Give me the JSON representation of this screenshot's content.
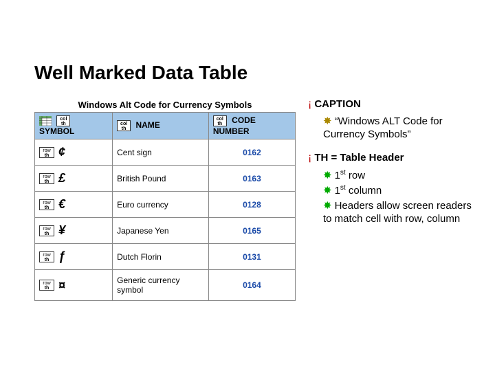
{
  "title": "Well Marked Data Table",
  "table": {
    "caption": "Windows Alt Code for Currency Symbols",
    "headers": {
      "symbol": "SYMBOL",
      "name": "NAME",
      "code": "CODE NUMBER"
    },
    "rows": [
      {
        "sym": "¢",
        "name": "Cent sign",
        "code": "0162"
      },
      {
        "sym": "£",
        "name": "British Pound",
        "code": "0163"
      },
      {
        "sym": "€",
        "name": "Euro currency",
        "code": "0128"
      },
      {
        "sym": "¥",
        "name": "Japanese Yen",
        "code": "0165"
      },
      {
        "sym": "ƒ",
        "name": "Dutch Florin",
        "code": "0131"
      },
      {
        "sym": "¤",
        "name": "Generic currency symbol",
        "code": "0164"
      }
    ]
  },
  "notes": {
    "caption_label": "CAPTION",
    "caption_text": "“Windows ALT Code for Currency Symbols”",
    "th_label": "TH = Table Header",
    "th_items": {
      "a": "1",
      "a_suffix": " row",
      "b": "1",
      "b_suffix": " column",
      "c": "Headers allow screen readers to match cell with row, column"
    },
    "st": "st"
  }
}
